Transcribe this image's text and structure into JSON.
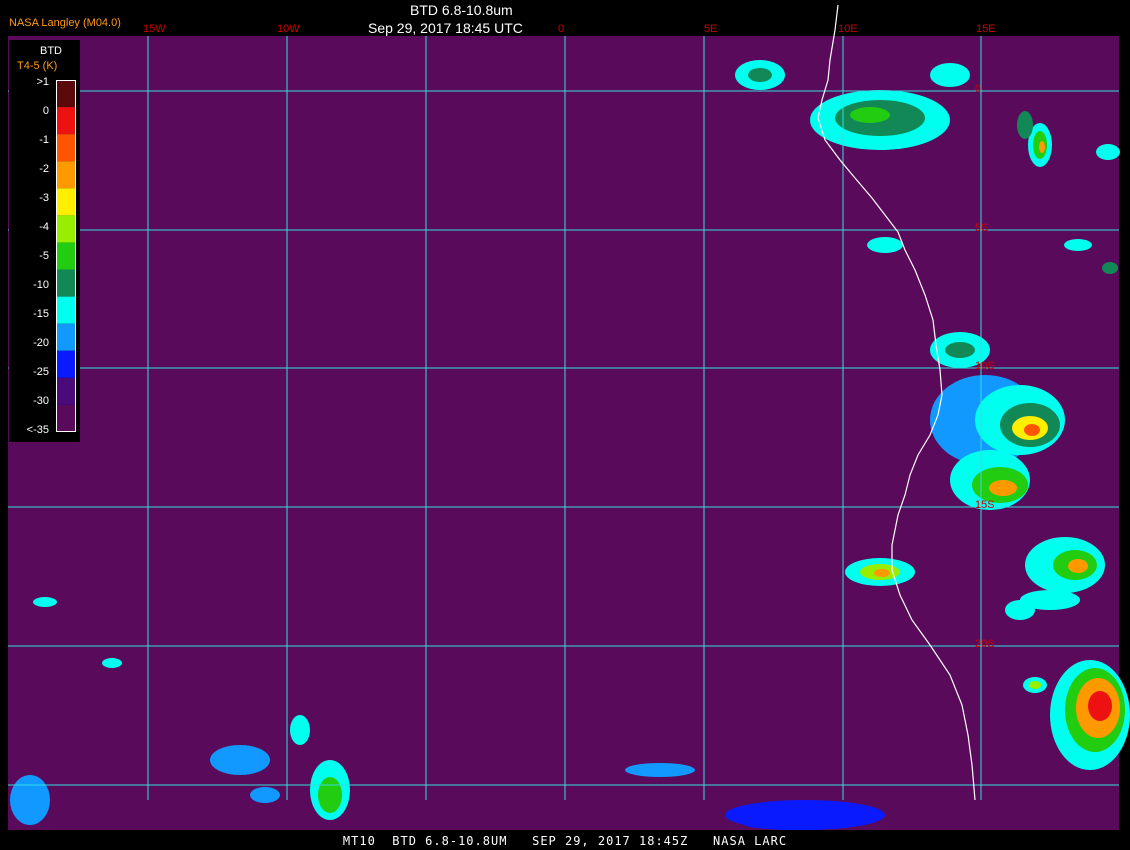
{
  "header": {
    "title": "BTD 6.8-10.8um",
    "subtitle": "Sep 29, 2017 18:45 UTC",
    "agency": "NASA Langley (M04.0)"
  },
  "legend": {
    "title": "BTD",
    "unit": "T4-5 (K)",
    "entries": [
      {
        "label": ">1",
        "color": "#5a0a0a"
      },
      {
        "label": "0",
        "color": "#ee1111"
      },
      {
        "label": "-1",
        "color": "#ff5500"
      },
      {
        "label": "-2",
        "color": "#ff9900"
      },
      {
        "label": "-3",
        "color": "#ffee00"
      },
      {
        "label": "-4",
        "color": "#99ee00"
      },
      {
        "label": "-5",
        "color": "#22cc11"
      },
      {
        "label": "-10",
        "color": "#118855"
      },
      {
        "label": "-15",
        "color": "#00ffee"
      },
      {
        "label": "-20",
        "color": "#1199ff"
      },
      {
        "label": "-25",
        "color": "#0a1aff"
      },
      {
        "label": "-30",
        "color": "#4a0a7a"
      },
      {
        "label": "<-35",
        "color": "#5a0a5a"
      }
    ]
  },
  "map": {
    "background_color": "#5a0a5a",
    "grid_color": "#33dddd",
    "coast_color": "#ffffff",
    "lon_labels": [
      "15W",
      "10W",
      "0",
      "5E",
      "10E",
      "15E"
    ],
    "lat_labels": [
      "0",
      "5S",
      "10S",
      "15S",
      "20S"
    ]
  },
  "footer": {
    "text": "MT10  BTD 6.8-10.8UM   SEP 29, 2017 18:45Z   NASA LARC"
  }
}
